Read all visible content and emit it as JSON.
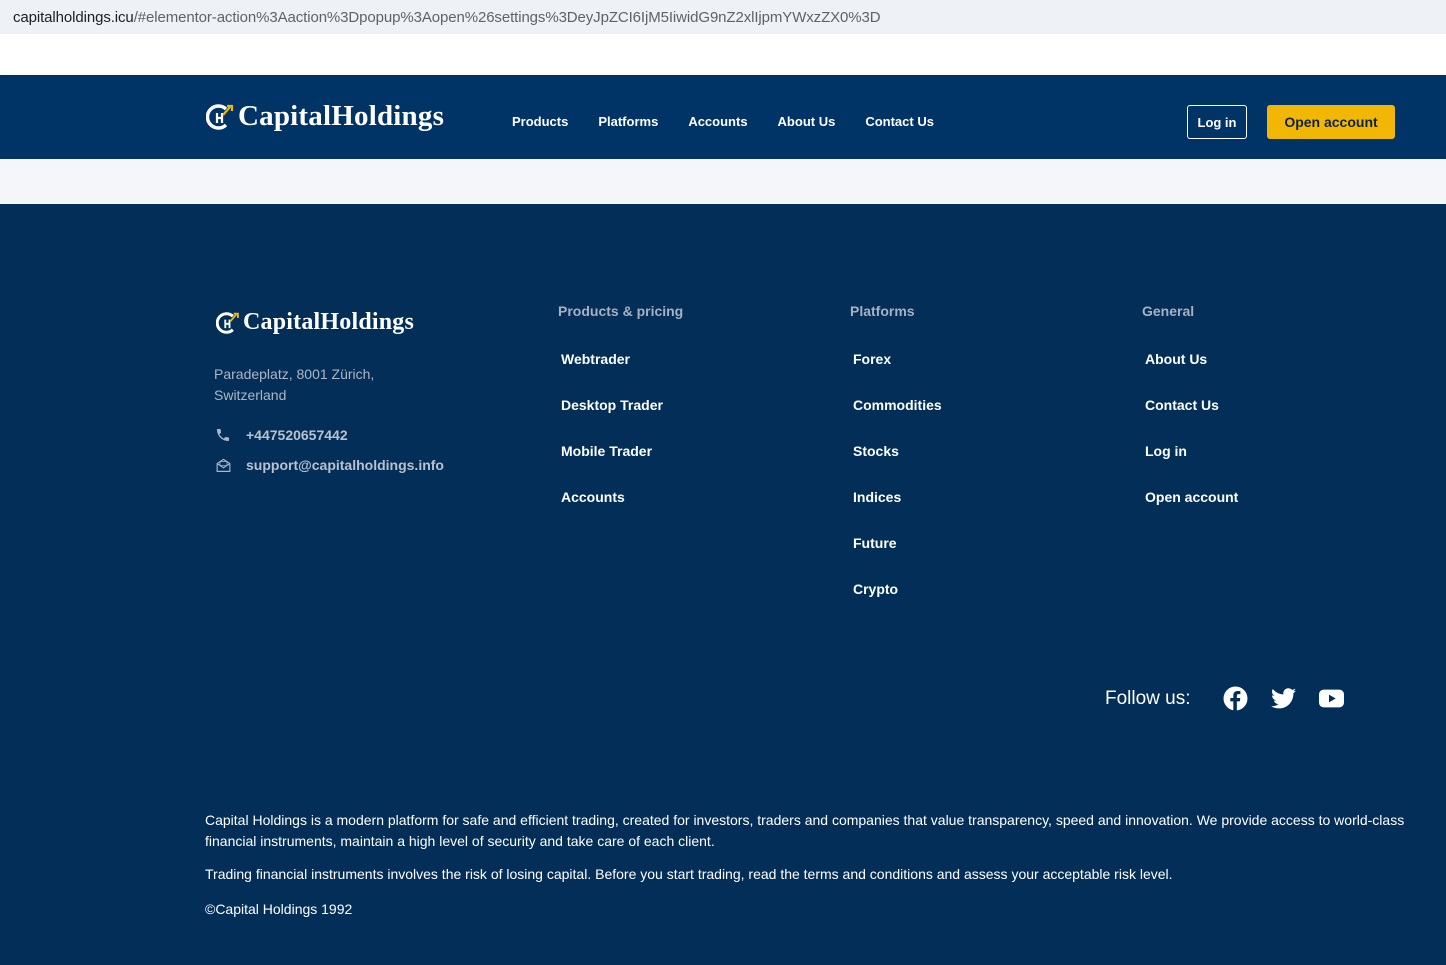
{
  "browser": {
    "url_host": "capitalholdings.icu",
    "url_rest": "/#elementor-action%3Aaction%3Dpopup%3Aopen%26settings%3DeyJpZCI6IjM5IiwidG9nZ2xlIjpmYWxzZX0%3D"
  },
  "header": {
    "logo_text": "CapitalHoldings",
    "nav": [
      "Products",
      "Platforms",
      "Accounts",
      "About Us",
      "Contact Us"
    ],
    "login_label": "Log in",
    "open_account_label": "Open account"
  },
  "footer": {
    "logo_text": "CapitalHoldings",
    "address": "Paradeplatz, 8001 Zürich, Switzerland",
    "phone": "+447520657442",
    "email": "support@capitalholdings.info",
    "columns": [
      {
        "heading": "Products & pricing",
        "links": [
          "Webtrader",
          "Desktop Trader",
          "Mobile Trader",
          "Accounts"
        ]
      },
      {
        "heading": "Platforms",
        "links": [
          "Forex",
          "Commodities",
          "Stocks",
          "Indices",
          "Future",
          "Crypto"
        ]
      },
      {
        "heading": "General",
        "links": [
          "About Us",
          "Contact Us",
          "Log in",
          "Open account"
        ]
      }
    ],
    "follow_label": "Follow us:",
    "social_icons": [
      "facebook-icon",
      "twitter-icon",
      "youtube-icon"
    ],
    "about_text": "Capital Holdings is a modern platform for safe and efficient trading, created for investors, traders and companies that value transparency, speed and innovation. We provide access to world-class financial instruments, maintain a high level of security and take care of each client.",
    "risk_text": "Trading financial instruments involves the risk of losing capital. Before you start trading, read the terms and conditions and assess your acceptable risk level.",
    "copyright": "©Capital Holdings 1992"
  },
  "colors": {
    "header_bg": "#003366",
    "footer_bg": "#022e57",
    "accent": "#f2b705"
  }
}
